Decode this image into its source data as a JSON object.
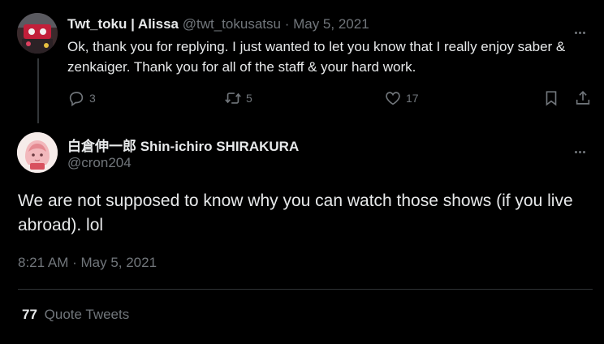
{
  "reply_tweet": {
    "display_name": "Twt_toku | Alissa",
    "handle": "@twt_tokusatsu",
    "separator": "·",
    "date": "May 5, 2021",
    "text": "Ok, thank you for replying. I just wanted to let you know that I really enjoy saber & zenkaiger. Thank you for all of the staff & your hard work.",
    "replies": "3",
    "retweets": "5",
    "likes": "17",
    "icons": [
      "reply-icon",
      "retweet-icon",
      "like-icon",
      "bookmark-icon",
      "share-icon",
      "more-icon"
    ]
  },
  "main_tweet": {
    "display_name": "白倉伸一郎 Shin-ichiro SHIRAKURA",
    "handle": "@cron204",
    "text": "We are not supposed to know why you can watch those shows (if you live abroad). lol",
    "timestamp": "8:21 AM · May 5, 2021"
  },
  "quote_tweets": {
    "count": "77",
    "label": "Quote Tweets"
  },
  "colors": {
    "background": "#000000",
    "text": "#e7e9ea",
    "muted": "#71767b",
    "divider": "#2f3336"
  }
}
